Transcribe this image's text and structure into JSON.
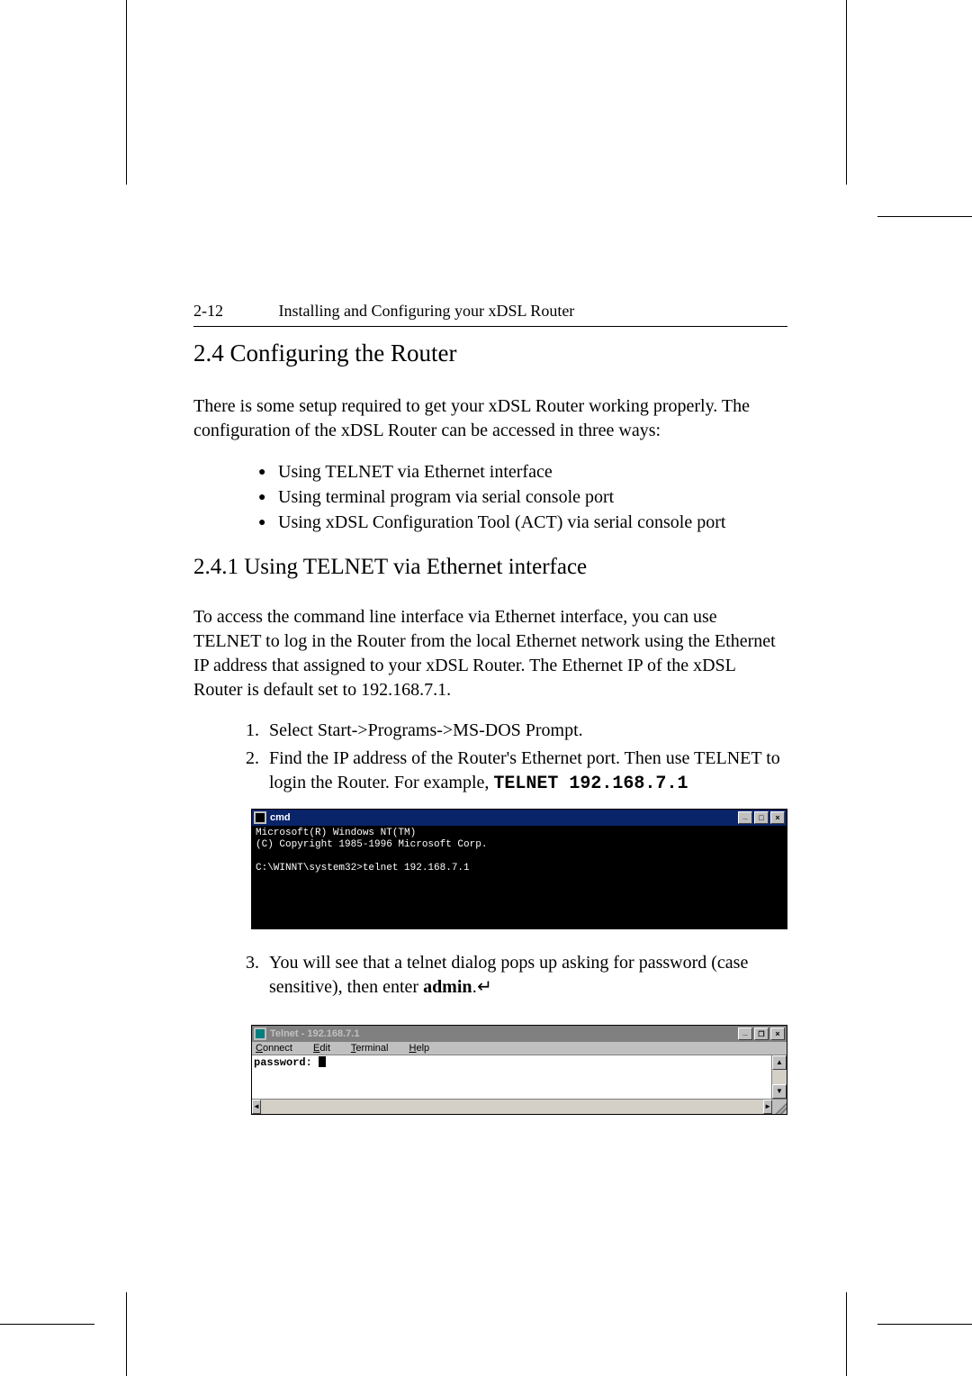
{
  "header": {
    "page_number": "2-12",
    "running_title": "Installing and Configuring your xDSL Router"
  },
  "section": {
    "number": "2.4",
    "title": "Configuring the Router"
  },
  "intro_para": "There is some setup required to get your xDSL Router working properly. The configuration of the xDSL Router can be accessed in three ways:",
  "bullets": [
    "Using TELNET via Ethernet interface",
    "Using terminal program via serial console port",
    "Using xDSL Configuration Tool (ACT) via serial console port"
  ],
  "subsection": {
    "number": "2.4.1",
    "title": "Using TELNET via Ethernet interface"
  },
  "sub_para": "To access the command line interface via Ethernet interface, you can use TELNET to log in the Router from the local Ethernet network using the Ethernet IP address that assigned to your xDSL Router. The Ethernet IP of the xDSL Router is default set to 192.168.7.1.",
  "steps": {
    "s1": "Select Start->Programs->MS-DOS Prompt.",
    "s2a": "Find the IP address of the Router's Ethernet port. Then use TELNET to login the Router. For example, ",
    "s2_cmd": "TELNET 192.168.7.1",
    "s3a": "You will see that a telnet dialog pops up asking for password (case sensitive), then enter  ",
    "s3_bold": "admin",
    "s3_tail": ".↵"
  },
  "cmd_window": {
    "title": "cmd",
    "line1": "Microsoft(R) Windows NT(TM)",
    "line2": "(C) Copyright 1985-1996 Microsoft Corp.",
    "prompt_line": "C:\\WINNT\\system32>telnet 192.168.7.1"
  },
  "telnet_window": {
    "title": "Telnet - 192.168.7.1",
    "menus": {
      "m1": "Connect",
      "m2": "Edit",
      "m3": "Terminal",
      "m4": "Help"
    },
    "prompt": "password: "
  }
}
